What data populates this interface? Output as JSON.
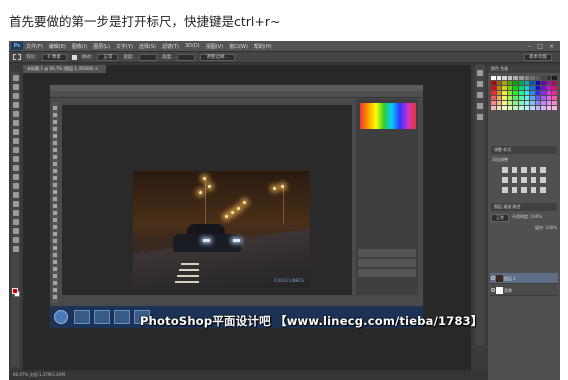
{
  "caption": "首先要做的第一步是打开标尺，快捷键是ctrl+r~",
  "app": {
    "logo": "Ps",
    "menu": [
      "文件(F)",
      "编辑(E)",
      "图像(I)",
      "图层(L)",
      "文字(Y)",
      "选择(S)",
      "滤镜(T)",
      "3D(D)",
      "视图(V)",
      "窗口(W)",
      "帮助(H)"
    ],
    "window_controls": [
      "–",
      "□",
      "×"
    ],
    "options": {
      "feather_label": "羽化:",
      "feather_value": "0 像素",
      "style_label": "样式:",
      "style_value": "正常",
      "width_label": "宽度:",
      "height_label": "高度:",
      "refine_label": "调整边缘...",
      "workspace": "基本功能"
    },
    "doc_tab": "未标题-1 @ 66.7% (图层 1, RGB/8) ×",
    "status": "66.67%    文档:1.37M/1.83M",
    "panels": {
      "color_tabs": "颜色   色板",
      "adjust_title": "调整   样式",
      "adjust_add": "添加调整",
      "layers_tabs": "图层   通道   路径",
      "blend_mode": "正常",
      "opacity_label": "不透明度: 100%",
      "fill_label": "填充: 100%",
      "layers": [
        {
          "name": "图层 1",
          "selected": true
        },
        {
          "name": "背景",
          "selected": false
        }
      ]
    }
  },
  "photo_watermark": "©2013 LINECG",
  "banner": "PhotoShop平面设计吧 【www.linecg.com/tieba/1783】",
  "colors": {
    "accent": "#d20000",
    "ps_blue": "#1e3d5e"
  }
}
